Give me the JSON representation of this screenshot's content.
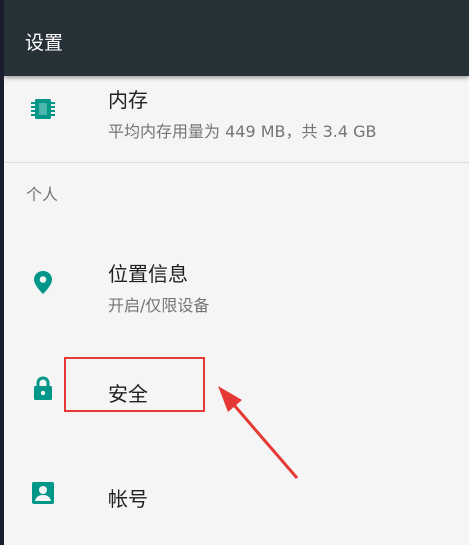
{
  "app_bar": {
    "title": "设置"
  },
  "storage": {
    "title": "内存",
    "summary": "平均内存用量为 449 MB，共 3.4 GB",
    "icon": "memory-chip-icon"
  },
  "section_personal": {
    "header": "个人"
  },
  "location": {
    "title": "位置信息",
    "summary": "开启/仅限设备",
    "icon": "location-pin-icon"
  },
  "security": {
    "title": "安全",
    "icon": "lock-icon"
  },
  "account": {
    "title": "帐号",
    "icon": "account-box-icon"
  },
  "colors": {
    "app_bar": "#263238",
    "icon_accent": "#009688",
    "annotation": "#e53935",
    "background": "#f5f5f5"
  }
}
